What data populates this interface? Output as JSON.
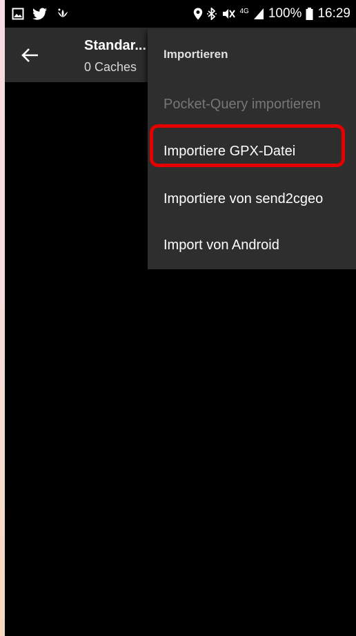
{
  "status_bar": {
    "left_icons": [
      "gallery-icon",
      "twitter-icon",
      "lotus-icon"
    ],
    "right_icons": [
      "location-icon",
      "bluetooth-icon",
      "mute-icon",
      "network-4g-icon",
      "signal-icon",
      "battery-icon"
    ],
    "network_label": "4G",
    "battery": "100%",
    "time": "16:29"
  },
  "app_bar": {
    "title": "Standar...",
    "subtitle": "0 Caches"
  },
  "menu": {
    "header": "Importieren",
    "items": [
      {
        "label": "Pocket-Query importieren",
        "enabled": false
      },
      {
        "label": "Importiere GPX-Datei",
        "enabled": true,
        "highlighted": true
      },
      {
        "label": "Importiere von send2cgeo",
        "enabled": true
      },
      {
        "label": "Import von Android",
        "enabled": true
      }
    ]
  },
  "colors": {
    "highlight": "#e60000",
    "app_bar": "#2c2c2c",
    "menu_bg": "#2e2e2e"
  }
}
